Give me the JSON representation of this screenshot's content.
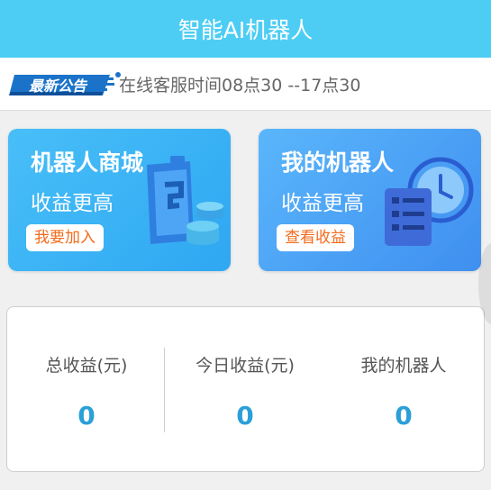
{
  "header": {
    "title": "智能AI机器人"
  },
  "notice": {
    "badge_label": "最新公告",
    "text": "在线客服时间08点30 --17点30"
  },
  "cards": [
    {
      "title": "机器人商城",
      "subtitle": "收益更高",
      "button": "我要加入"
    },
    {
      "title": "我的机器人",
      "subtitle": "收益更高",
      "button": "查看收益"
    }
  ],
  "stats": [
    {
      "label": "总收益(元)",
      "value": "0"
    },
    {
      "label": "今日收益(元)",
      "value": "0"
    },
    {
      "label": "我的机器人",
      "value": "0"
    }
  ],
  "colors": {
    "header_bg": "#4dcdf4",
    "card_button_text": "#f36b1c",
    "stat_value": "#2a9fd8"
  }
}
